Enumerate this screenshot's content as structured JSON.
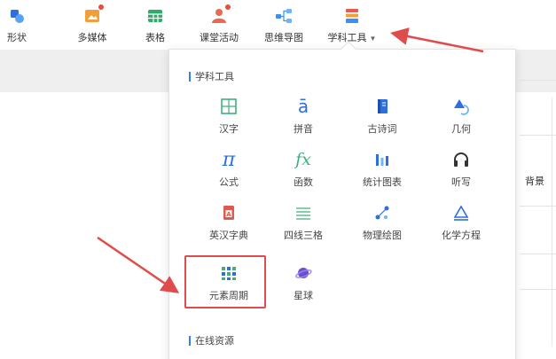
{
  "toolbar": {
    "items": [
      {
        "label": "形状",
        "icon": "shape-icon"
      },
      {
        "label": "多媒体",
        "icon": "multimedia-icon"
      },
      {
        "label": "表格",
        "icon": "table-icon"
      },
      {
        "label": "课堂活动",
        "icon": "classroom-activity-icon"
      },
      {
        "label": "思维导图",
        "icon": "mind-map-icon"
      },
      {
        "label": "学科工具",
        "icon": "subject-tools-icon",
        "caret": "▼"
      }
    ]
  },
  "panel": {
    "section1_title": "学科工具",
    "section2_title": "在线资源",
    "tools": [
      {
        "label": "汉字",
        "glyph": "田",
        "icon": "chinese-character-icon",
        "color": "#3fb07c"
      },
      {
        "label": "拼音",
        "glyph": "ā",
        "icon": "pinyin-icon",
        "color": "#2f6fdc"
      },
      {
        "label": "古诗词",
        "glyph": "",
        "icon": "poetry-book-icon",
        "color": "#2f6fdc"
      },
      {
        "label": "几何",
        "glyph": "",
        "icon": "geometry-icon",
        "color": "#2f6fdc"
      },
      {
        "label": "公式",
        "glyph": "π",
        "icon": "pi-icon",
        "color": "#2f6fdc"
      },
      {
        "label": "函数",
        "glyph": "fx",
        "icon": "function-icon",
        "color": "#3fb07c"
      },
      {
        "label": "统计图表",
        "glyph": "",
        "icon": "statistics-chart-icon",
        "color": "#2f6fdc"
      },
      {
        "label": "听写",
        "glyph": "",
        "icon": "headphones-icon",
        "color": "#333333"
      },
      {
        "label": "英汉字典",
        "glyph": "A",
        "icon": "dictionary-icon",
        "color": "#e05a4e"
      },
      {
        "label": "四线三格",
        "glyph": "",
        "icon": "four-line-grid-icon",
        "color": "#3fb07c"
      },
      {
        "label": "物理绘图",
        "glyph": "",
        "icon": "physics-drawing-icon",
        "color": "#2f6fdc"
      },
      {
        "label": "化学方程",
        "glyph": "",
        "icon": "chemistry-equation-icon",
        "color": "#2f6fdc"
      },
      {
        "label": "元素周期",
        "glyph": "",
        "icon": "periodic-table-icon",
        "color": "#3fb07c"
      },
      {
        "label": "星球",
        "glyph": "",
        "icon": "planet-icon",
        "color": "#6b4fd0"
      }
    ]
  },
  "side_text": "背景",
  "colors": {
    "accent": "#2f7ef7",
    "annotation_red": "#e04b4b"
  }
}
